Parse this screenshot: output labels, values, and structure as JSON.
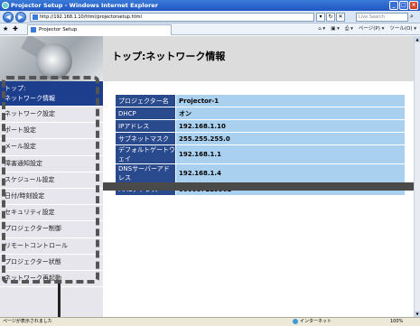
{
  "window": {
    "title": "Projector Setup - Windows Internet Explorer",
    "controls": [
      "_",
      "□",
      "×"
    ]
  },
  "address_bar": {
    "url": "http://192.168.1.10/html/projectorsetup.html",
    "search_placeholder": "Live Search",
    "back_glyph": "◀",
    "forward_glyph": "▶",
    "go_glyphs": [
      "▾",
      "↻",
      "✕"
    ],
    "search_glyph": "⌕"
  },
  "tab_bar": {
    "favorites_glyphs": [
      "★",
      "✚"
    ],
    "tab_title": "Projector Setup",
    "commands": [
      "⌂ ▾",
      "▣ ▾",
      "⎙ ▾",
      "ページ(P) ▾",
      "ツール(O) ▾"
    ]
  },
  "page": {
    "title": "トップ:ネットワーク情報",
    "menu": [
      {
        "label": "トップ:"
      },
      {
        "label": "ネットワーク情報",
        "active": true
      },
      {
        "label": "ネットワーク設定"
      },
      {
        "label": "ポート設定"
      },
      {
        "label": "メール設定"
      },
      {
        "label": "障害通知設定"
      },
      {
        "label": "スケジュール設定"
      },
      {
        "label": "日付/時刻設定"
      },
      {
        "label": "セキュリティ設定"
      },
      {
        "label": "プロジェクター制御"
      },
      {
        "label": "リモートコントロール"
      },
      {
        "label": "プロジェクター状態"
      },
      {
        "label": "ネットワーク再起動"
      }
    ],
    "info_table": [
      {
        "key": "プロジェクター名",
        "value": "Projector-1"
      },
      {
        "key": "DHCP",
        "value": "オン"
      },
      {
        "key": "IPアドレス",
        "value": "192.168.1.10"
      },
      {
        "key": "サブネットマスク",
        "value": "255.255.255.0"
      },
      {
        "key": "デフォルトゲートウェイ",
        "value": "192.168.1.1"
      },
      {
        "key": "DNSサーバーアドレス",
        "value": "192.168.1.4"
      },
      {
        "key": "MACアドレス",
        "value": "0000872E956D"
      }
    ]
  },
  "status_bar": {
    "left": "ページが表示されました",
    "zone": "インターネット",
    "zoom": "100%"
  },
  "colors": {
    "menu_active": "#1c3e8c",
    "table_key": "#2a4a8e",
    "table_value": "#a9d0ef",
    "title_bar": "#1f56c2"
  }
}
